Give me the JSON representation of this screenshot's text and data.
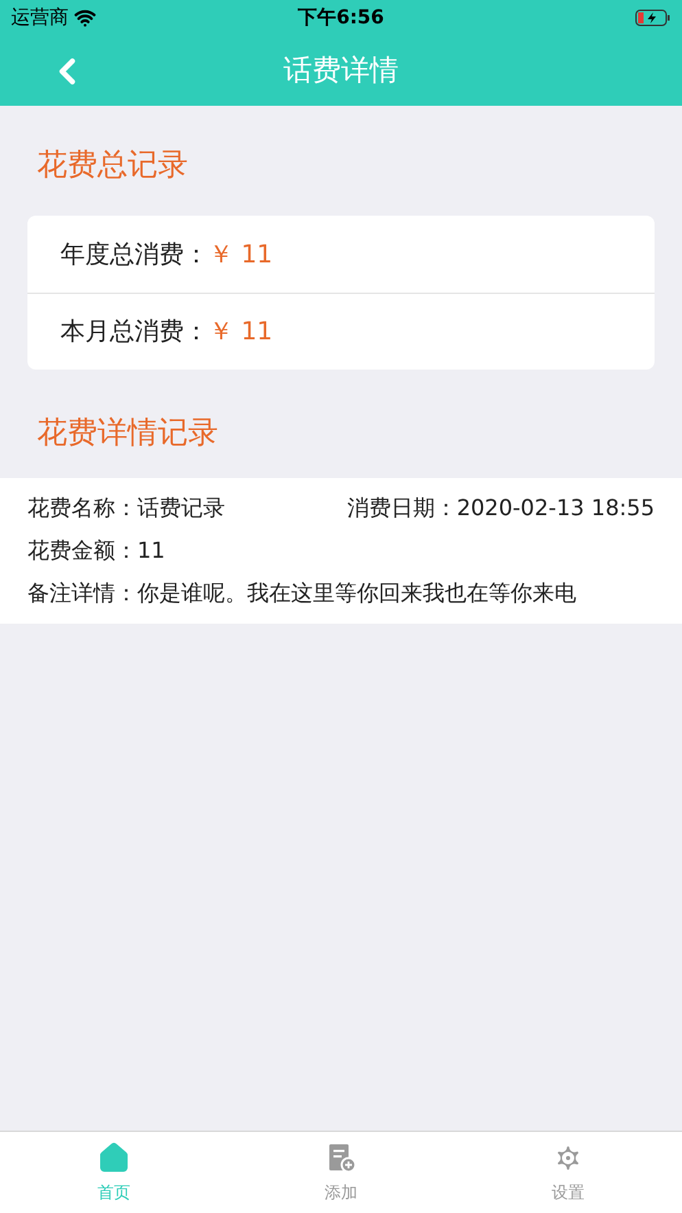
{
  "status_bar": {
    "carrier": "运营商",
    "time": "下午6:56"
  },
  "nav": {
    "title": "话费详情"
  },
  "summary": {
    "title": "花费总记录",
    "rows": [
      {
        "label": "年度总消费：",
        "value": "￥ 11"
      },
      {
        "label": "本月总消费：",
        "value": "￥ 11"
      }
    ]
  },
  "detail": {
    "title": "花费详情记录",
    "name_label": "花费名称：",
    "name": "话费记录",
    "date_label": "消费日期：",
    "date": "2020-02-13 18:55",
    "amount_label": "花费金额：",
    "amount": "11",
    "note_label": "备注详情：",
    "note": "你是谁呢。我在这里等你回来我也在等你来电"
  },
  "tabs": [
    {
      "kind": "home",
      "label": "首页",
      "selected": true
    },
    {
      "kind": "add",
      "label": "添加",
      "selected": false
    },
    {
      "kind": "settings",
      "label": "设置",
      "selected": false
    }
  ]
}
